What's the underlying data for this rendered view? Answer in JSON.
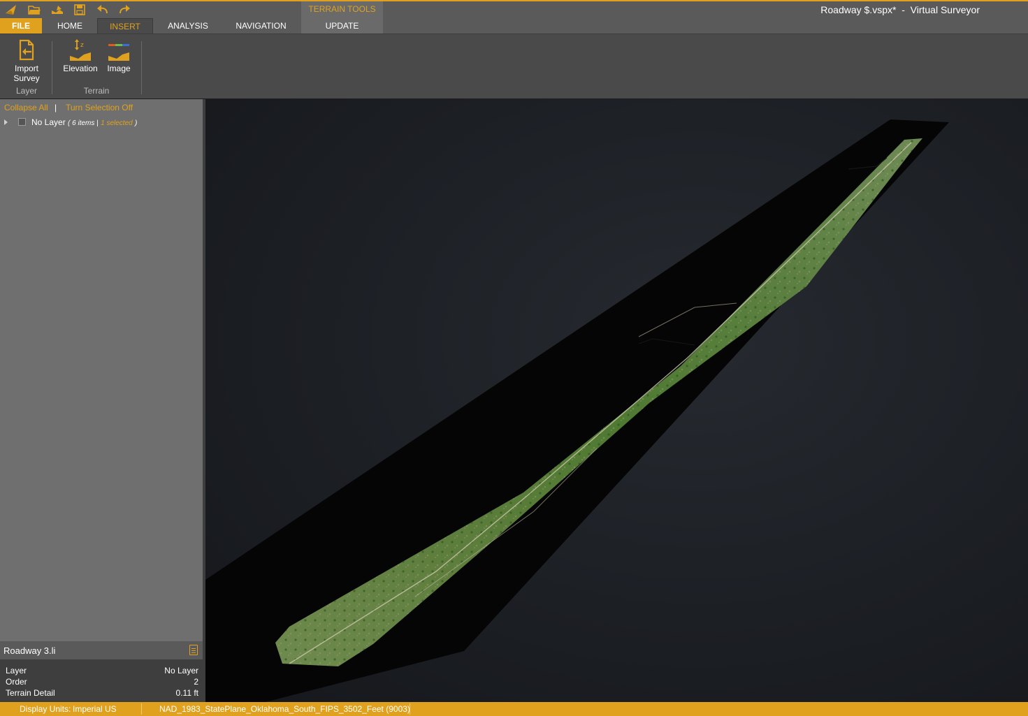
{
  "window": {
    "title": "Roadway $.vspx*  -  Virtual Surveyor"
  },
  "quick_access": [
    {
      "name": "app-logo-icon"
    },
    {
      "name": "open-folder-icon"
    },
    {
      "name": "edit-project-icon"
    },
    {
      "name": "save-icon"
    },
    {
      "name": "undo-icon"
    },
    {
      "name": "redo-icon"
    }
  ],
  "tabs": {
    "file": "FILE",
    "home": "HOME",
    "insert": "INSERT",
    "analysis": "ANALYSIS",
    "navigation": "NAVIGATION",
    "context_group": "TERRAIN TOOLS",
    "update": "UPDATE"
  },
  "ribbon": {
    "import_survey": "Import\nSurvey",
    "import_survey_line1": "Import",
    "import_survey_line2": "Survey",
    "group_layer": "Layer",
    "elevation": "Elevation",
    "image": "Image",
    "group_terrain": "Terrain"
  },
  "layers_panel": {
    "collapse_all": "Collapse All",
    "separator": "|",
    "turn_selection_off": "Turn Selection Off",
    "tree": {
      "label": "No Layer",
      "count": "( 6 items |",
      "selected": "1 selected",
      "close": ")"
    }
  },
  "properties": {
    "title": "Roadway 3.li",
    "rows": [
      {
        "key": "Layer",
        "value": "No Layer"
      },
      {
        "key": "Order",
        "value": "2"
      },
      {
        "key": "Terrain Detail",
        "value": "0.11 ft"
      }
    ]
  },
  "statusbar": {
    "units_label": "Display Units:",
    "units_value": "Imperial US",
    "crs": "NAD_1983_StatePlane_Oklahoma_South_FIPS_3502_Feet (9003)"
  },
  "colors": {
    "accent": "#e0a21e",
    "ribbon_bg": "#4a4a4a",
    "panel_bg": "#6f6f6f",
    "viewport_bg": "#1c1f24"
  }
}
